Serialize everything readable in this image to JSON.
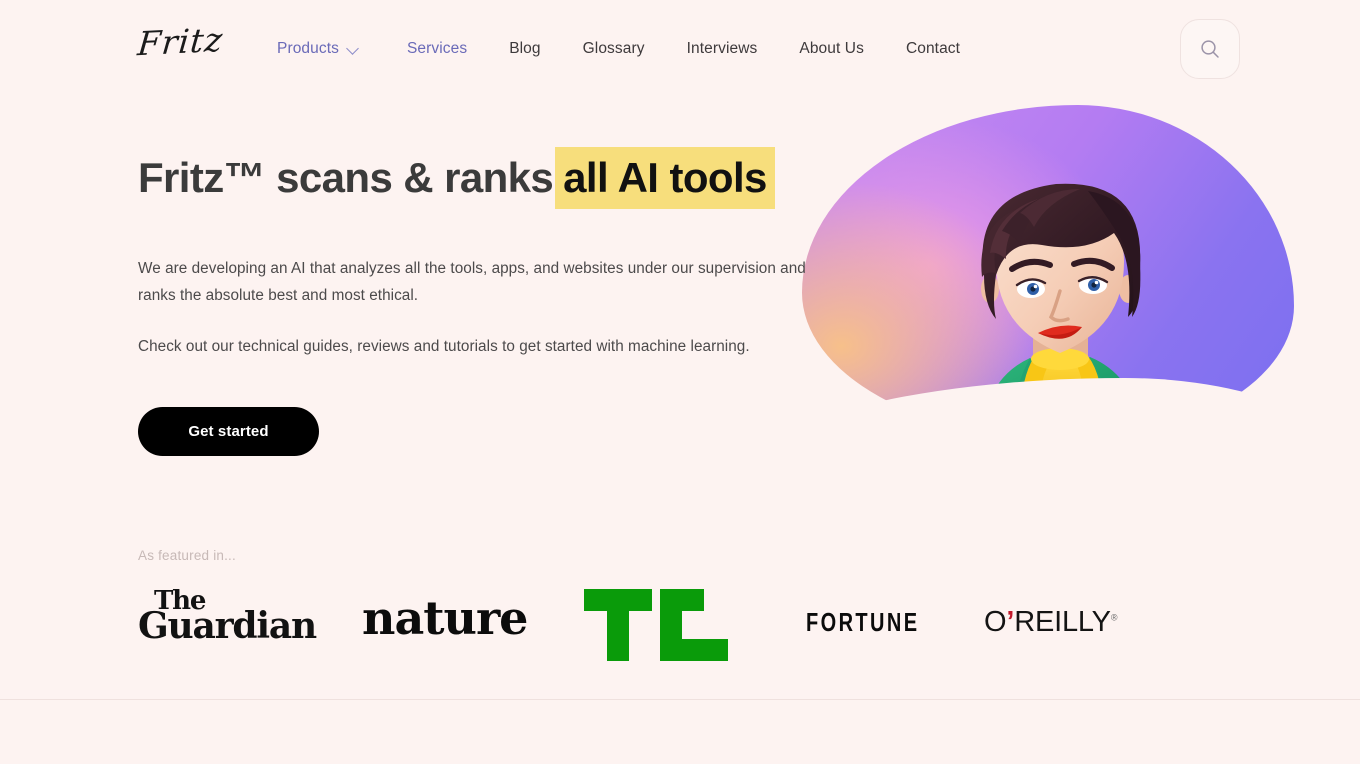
{
  "site": {
    "background_color": "#FDF3F1",
    "accent_color": "#6A6AB8",
    "highlight_color": "#F7DE7C",
    "logo_text": "Fritz"
  },
  "header": {
    "nav": [
      {
        "label": "Products",
        "accent": true,
        "has_dropdown": true,
        "icon": "chevron-down-icon"
      },
      {
        "label": "Services",
        "accent": true,
        "has_dropdown": false,
        "icon": ""
      },
      {
        "label": "Blog",
        "accent": false,
        "has_dropdown": false,
        "icon": ""
      },
      {
        "label": "Glossary",
        "accent": false,
        "has_dropdown": false,
        "icon": ""
      },
      {
        "label": "Interviews",
        "accent": false,
        "has_dropdown": false,
        "icon": ""
      },
      {
        "label": "About Us",
        "accent": false,
        "has_dropdown": false,
        "icon": ""
      },
      {
        "label": "Contact",
        "accent": false,
        "has_dropdown": false,
        "icon": ""
      }
    ],
    "search": {
      "icon": "search-icon",
      "aria_label": "Search"
    }
  },
  "hero": {
    "headline_plain": "Fritz™ scans & ranks",
    "headline_highlight": "all AI tools",
    "paragraph_1": "We are developing an AI that analyzes all the tools, apps, and websites under our supervision and ranks the absolute best and most ethical.",
    "paragraph_2": "Check out our technical guides, reviews and tutorials to get started with machine learning.",
    "cta_label": "Get started",
    "illustration": {
      "name": "woman-3d-illustration",
      "description": "3D illustrated woman with dark wavy hair, green jacket and yellow scarf on a purple-pink-orange gradient blob",
      "blob_colors": [
        "#F7C08A",
        "#EE9CE4",
        "#C88CF0",
        "#8A73F0",
        "#7A6FF0"
      ],
      "hair_color": "#3B2028",
      "skin_color": "#F6D3C0",
      "jacket_color": "#21A06A",
      "scarf_color": "#F5C800",
      "lips_color": "#E02B1E"
    }
  },
  "featured": {
    "label": "As featured in...",
    "logos": [
      {
        "name": "the-guardian-logo",
        "line1": "The",
        "line2": "Guardian"
      },
      {
        "name": "nature-logo",
        "text": "nature"
      },
      {
        "name": "techcrunch-logo",
        "text": "TC",
        "color": "#0A9B0A"
      },
      {
        "name": "fortune-logo",
        "text": "FORTUNE"
      },
      {
        "name": "oreilly-logo",
        "pre": "O",
        "apos": "’",
        "post": "REILLY",
        "reg": "®",
        "apos_color": "#C3192B"
      }
    ]
  }
}
